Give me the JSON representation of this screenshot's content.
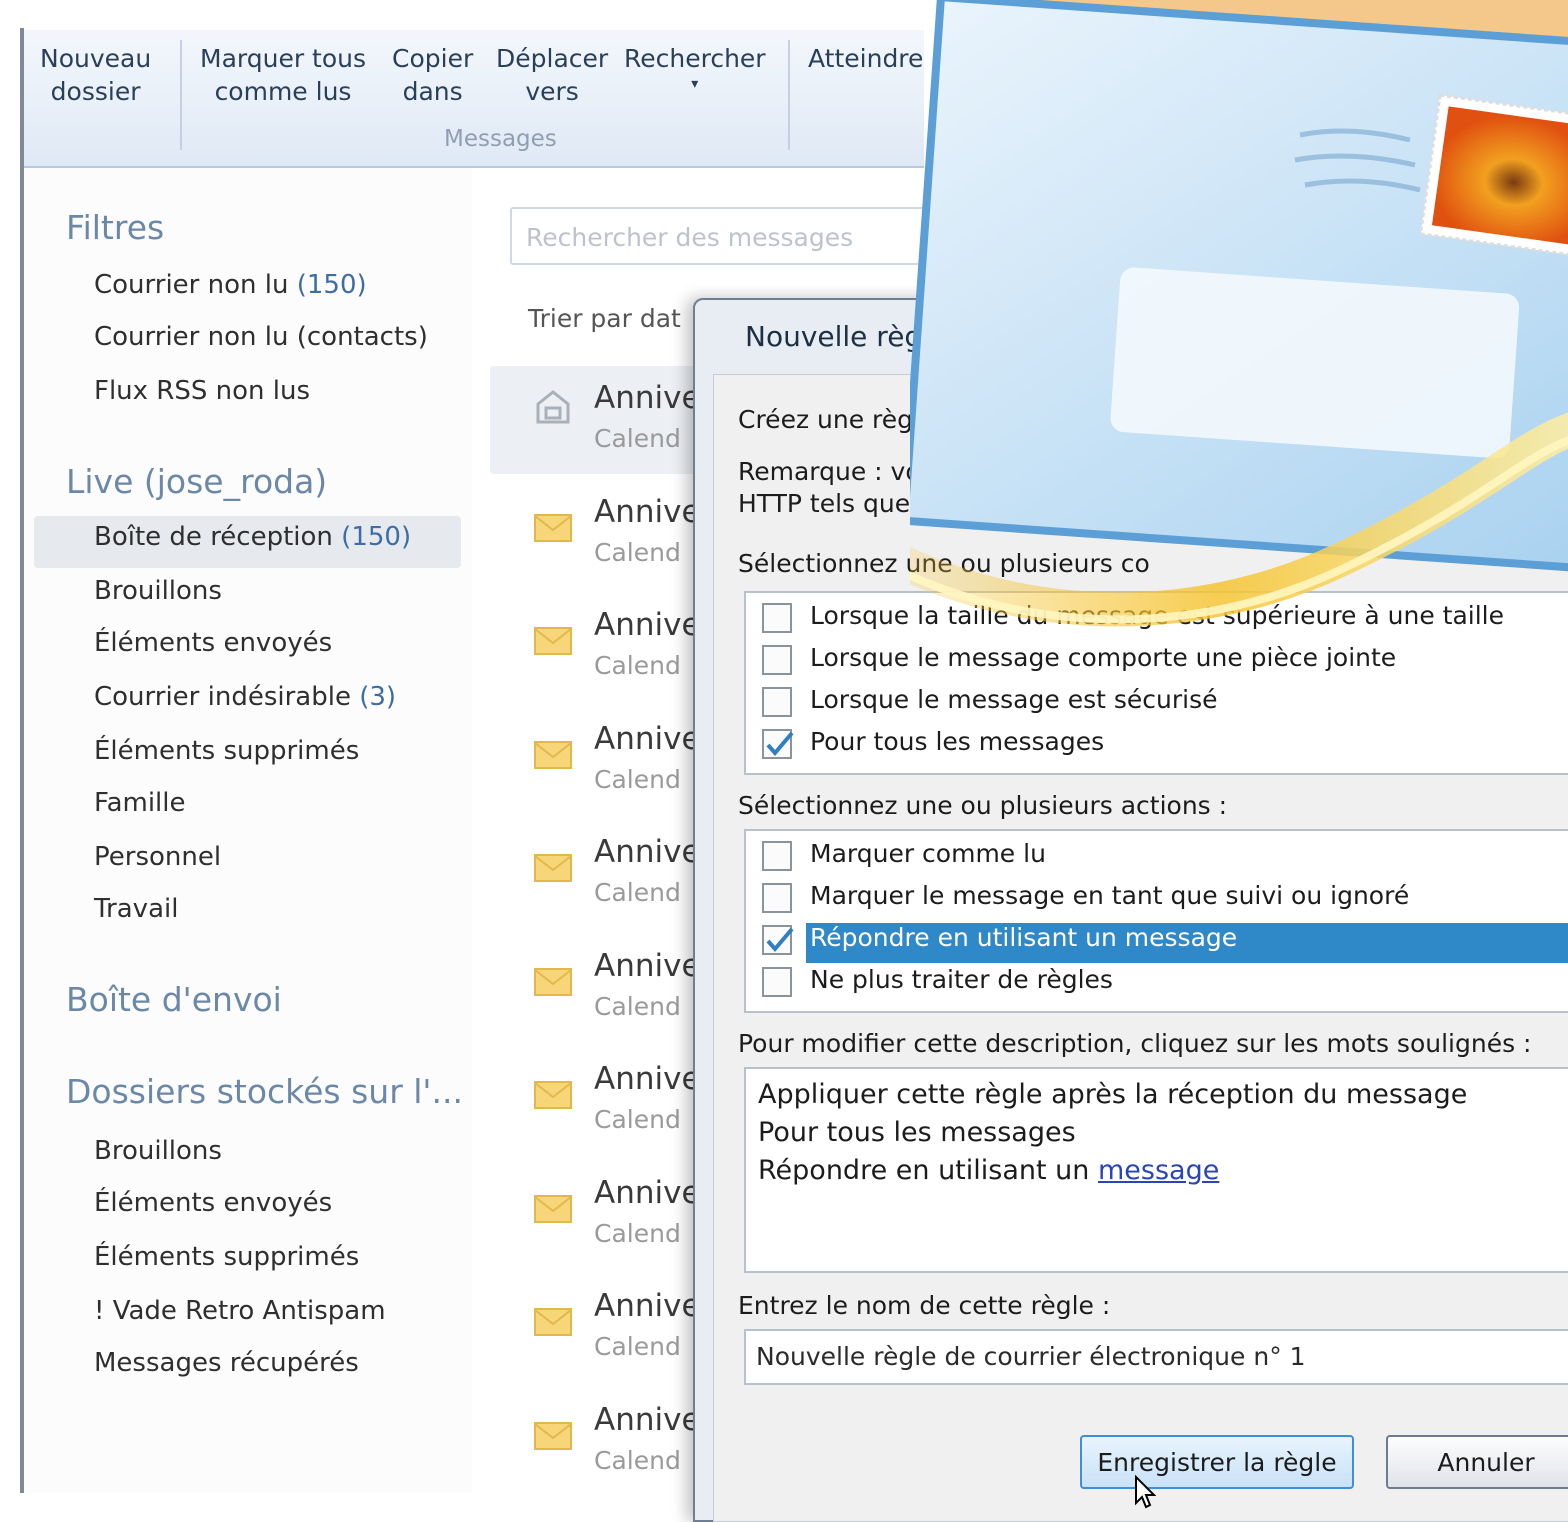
{
  "ribbon": {
    "buttons": [
      {
        "line1": "Nouveau",
        "line2": "dossier"
      },
      {
        "line1": "Marquer tous",
        "line2": "comme lus"
      },
      {
        "line1": "Copier",
        "line2": "dans"
      },
      {
        "line1": "Déplacer",
        "line2": "vers"
      },
      {
        "line1": "Rechercher",
        "line2": "▾"
      },
      {
        "line1": "Atteindre",
        "line2": ""
      }
    ],
    "group_label": "Messages"
  },
  "sidebar": {
    "filters_title": "Filtres",
    "filters": [
      {
        "label": "Courrier non lu ",
        "count": "(150)"
      },
      {
        "label": "Courrier non lu (contacts)",
        "count": ""
      },
      {
        "label": "Flux RSS non lus",
        "count": ""
      }
    ],
    "account_title": "Live (jose_roda)",
    "account_folders": [
      {
        "label": "Boîte de réception ",
        "count": "(150)"
      },
      {
        "label": "Brouillons",
        "count": ""
      },
      {
        "label": "Éléments envoyés",
        "count": ""
      },
      {
        "label": "Courrier indésirable ",
        "count": "(3)"
      },
      {
        "label": "Éléments supprimés",
        "count": ""
      },
      {
        "label": "Famille",
        "count": ""
      },
      {
        "label": "Personnel",
        "count": ""
      },
      {
        "label": "Travail",
        "count": ""
      }
    ],
    "outbox_title": "Boîte d'envoi",
    "stored_title": "Dossiers stockés sur l'...",
    "stored_folders": [
      {
        "label": "Brouillons"
      },
      {
        "label": "Éléments envoyés"
      },
      {
        "label": "Éléments supprimés"
      },
      {
        "label": "! Vade Retro Antispam"
      },
      {
        "label": "Messages récupérés"
      }
    ]
  },
  "message_list": {
    "search_placeholder": "Rechercher des messages",
    "sort_label": "Trier par dat",
    "rows": [
      {
        "sender": "Annive",
        "subject": "Calend"
      },
      {
        "sender": "Annive",
        "subject": "Calend"
      },
      {
        "sender": "Annive",
        "subject": "Calend"
      },
      {
        "sender": "Annive",
        "subject": "Calend"
      },
      {
        "sender": "Annive",
        "subject": "Calend"
      },
      {
        "sender": "Annive",
        "subject": "Calend"
      },
      {
        "sender": "Annive",
        "subject": "Calend"
      },
      {
        "sender": "Annive",
        "subject": "Calend"
      },
      {
        "sender": "Annive",
        "subject": "Calend"
      },
      {
        "sender": "Annive",
        "subject": "Calend"
      }
    ]
  },
  "dialog": {
    "title": "Nouvelle règ",
    "intro": "Créez une règle",
    "remark_line1": "Remarque : vo",
    "remark_line2": "HTTP tels que",
    "conditions_label": "Sélectionnez une ou plusieurs co",
    "conditions": [
      {
        "label": "Lorsque la taille du message est supérieure à une taille",
        "checked": false
      },
      {
        "label": "Lorsque le message comporte une pièce jointe",
        "checked": false
      },
      {
        "label": "Lorsque le message est sécurisé",
        "checked": false
      },
      {
        "label": "Pour tous les messages",
        "checked": true
      }
    ],
    "actions_label": "Sélectionnez une ou plusieurs actions :",
    "actions": [
      {
        "label": "Marquer comme lu",
        "checked": false
      },
      {
        "label": "Marquer le message en tant que suivi ou ignoré",
        "checked": false
      },
      {
        "label": "Répondre en utilisant un message",
        "checked": true
      },
      {
        "label": "Ne plus traiter de règles",
        "checked": false
      }
    ],
    "description_label": "Pour modifier cette description, cliquez sur les mots soulignés :",
    "description_lines": [
      "Appliquer cette règle après la réception du message",
      "Pour tous les messages",
      "Répondre en utilisant un "
    ],
    "description_link": "message",
    "name_label": "Entrez le nom de cette règle :",
    "name_value": "Nouvelle règle de courrier électronique n° 1",
    "save_button": "Enregistrer la règle",
    "cancel_button": "Annuler"
  },
  "colors": {
    "accent": "#2f88c8",
    "link": "#2a45b8",
    "heading": "#6b88a8"
  },
  "icons": {
    "message_row": "envelope-icon",
    "selected_row": "calendar-house-icon",
    "logo": "windows-live-mail-envelope-logo"
  }
}
